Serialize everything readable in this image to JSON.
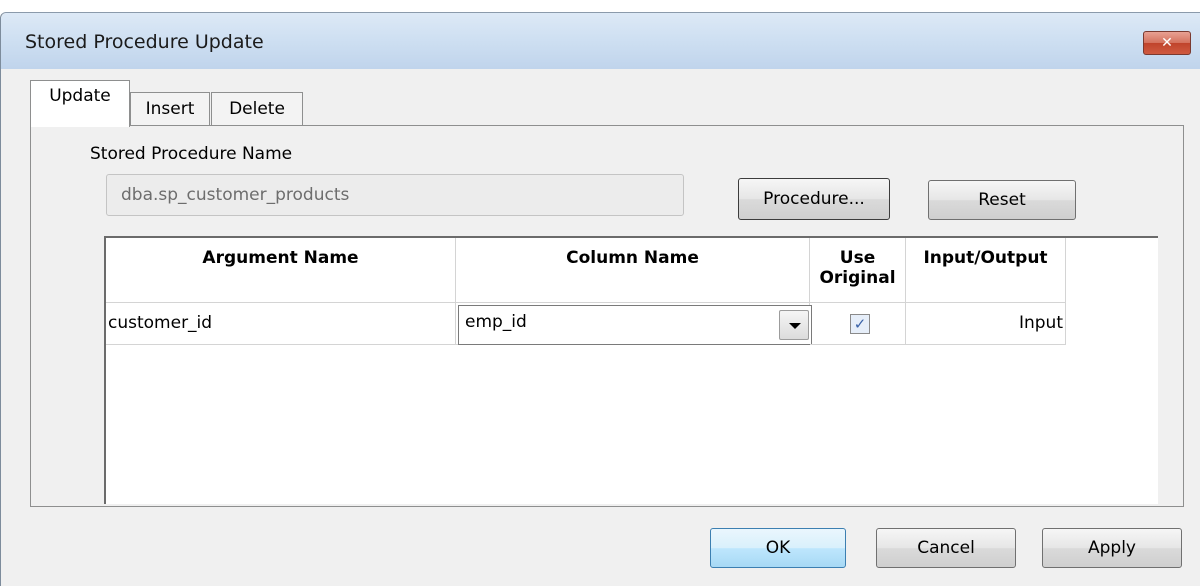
{
  "window": {
    "title": "Stored Procedure Update",
    "close_glyph": "✕"
  },
  "tabs": [
    {
      "label": "Update",
      "active": true
    },
    {
      "label": "Insert",
      "active": false
    },
    {
      "label": "Delete",
      "active": false
    }
  ],
  "form": {
    "sp_name_label": "Stored Procedure Name",
    "sp_name_value": "dba.sp_customer_products",
    "procedure_button": "Procedure...",
    "reset_button": "Reset"
  },
  "grid": {
    "headers": {
      "argument": "Argument Name",
      "column": "Column Name",
      "use_original_1": "Use",
      "use_original_2": "Original",
      "io": "Input/Output"
    },
    "rows": [
      {
        "argument": "customer_id",
        "column": "emp_id",
        "use_original": true,
        "io": "Input"
      }
    ]
  },
  "footer": {
    "ok": "OK",
    "cancel": "Cancel",
    "apply": "Apply"
  },
  "colors": {
    "titlebar": "#cfe0f2",
    "close_button": "#c0442c",
    "default_button": "#a7d9f5"
  }
}
